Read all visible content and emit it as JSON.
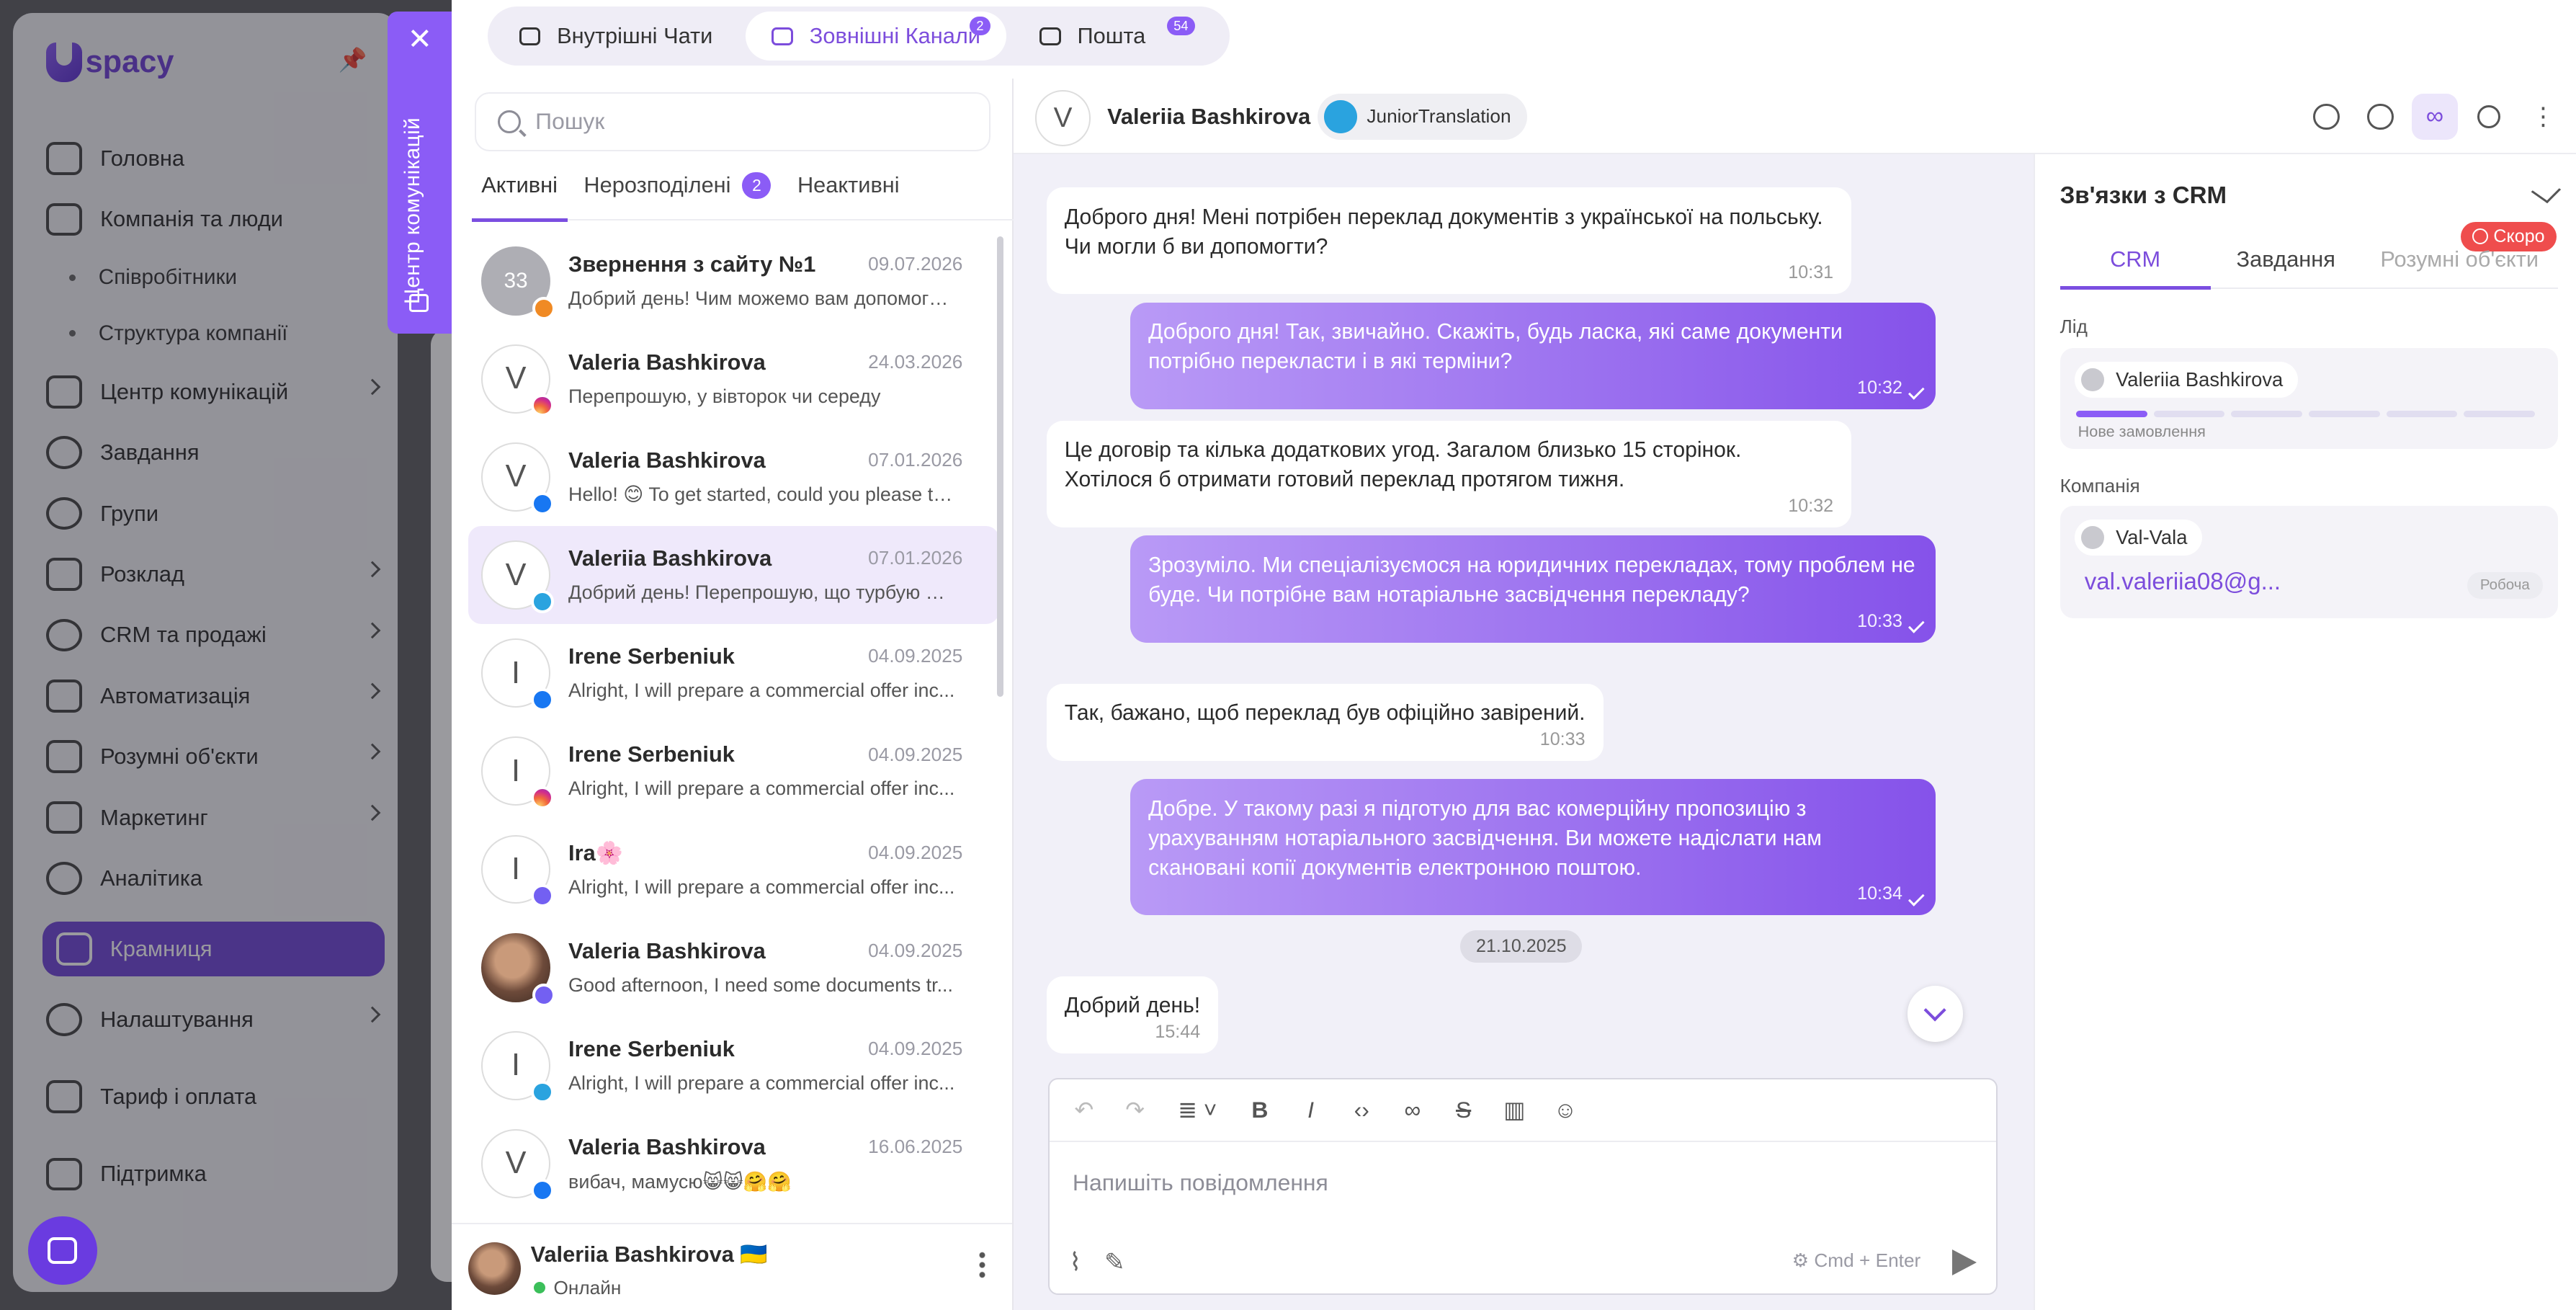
{
  "app": {
    "brand": "spacy",
    "nav": [
      {
        "label": "Головна"
      },
      {
        "label": "Компанія та люди"
      },
      {
        "label": "Співробітники",
        "sub": true
      },
      {
        "label": "Структура компанії",
        "sub": true
      },
      {
        "label": "Центр комунікацій"
      },
      {
        "label": "Завдання"
      },
      {
        "label": "Групи"
      },
      {
        "label": "Розклад"
      },
      {
        "label": "CRM та продажі"
      },
      {
        "label": "Автоматизація"
      },
      {
        "label": "Розумні об'єкти"
      },
      {
        "label": "Маркетинг"
      },
      {
        "label": "Аналітика"
      },
      {
        "label": "Крамниця"
      },
      {
        "label": "Налаштування"
      },
      {
        "label": "Тариф і оплата"
      },
      {
        "label": "Підтримка"
      }
    ]
  },
  "commtab": {
    "label": "Центр комунікацій",
    "close": "✕"
  },
  "tabs": [
    {
      "label": "Внутрішні Чати",
      "badge": ""
    },
    {
      "label": "Зовнішні Канали",
      "badge": "2"
    },
    {
      "label": "Пошта",
      "badge": "54"
    }
  ],
  "search": {
    "placeholder": "Пошук"
  },
  "list_tabs": [
    {
      "label": "Активні"
    },
    {
      "label": "Нерозподілені",
      "count": "2"
    },
    {
      "label": "Неактивні"
    }
  ],
  "chats": [
    {
      "initial": "33",
      "name": "Звернення з сайту №1",
      "date": "09.07.2026",
      "preview": "Добрий день! Чим можемо вам допомогти?",
      "channel": "site"
    },
    {
      "initial": "V",
      "name": "Valeria Bashkirova",
      "date": "24.03.2026",
      "preview": "Перепрошую, у вівторок чи середу",
      "channel": "instagram"
    },
    {
      "initial": "V",
      "name": "Valeria Bashkirova",
      "date": "07.01.2026",
      "preview": "Hello! 😊 To get started, could you please te...",
      "channel": "facebook"
    },
    {
      "initial": "V",
      "name": "Valeriia Bashkirova",
      "date": "07.01.2026",
      "preview": "Добрий день! Перепрошую, що турбую щ...",
      "channel": "telegram"
    },
    {
      "initial": "I",
      "name": "Irene Serbeniuk",
      "date": "04.09.2025",
      "preview": "Alright, I will prepare a commercial offer inc...",
      "channel": "facebook"
    },
    {
      "initial": "I",
      "name": "Irene Serbeniuk",
      "date": "04.09.2025",
      "preview": "Alright, I will prepare a commercial offer inc...",
      "channel": "instagram"
    },
    {
      "initial": "I",
      "name": "Ira🌸",
      "date": "04.09.2025",
      "preview": "Alright, I will prepare a commercial offer inc...",
      "channel": "viber"
    },
    {
      "initial": "",
      "name": "Valeria Bashkirova",
      "date": "04.09.2025",
      "preview": "Good afternoon, I need some documents tr...",
      "channel": "viber"
    },
    {
      "initial": "I",
      "name": "Irene Serbeniuk",
      "date": "04.09.2025",
      "preview": "Alright, I will prepare a commercial offer inc...",
      "channel": "telegram"
    },
    {
      "initial": "V",
      "name": "Valeria Bashkirova",
      "date": "16.06.2025",
      "preview": "вибач, мамусю😸😸🤗🤗",
      "channel": "facebook"
    }
  ],
  "me": {
    "name": "Valeriia Bashkirova 🇺🇦",
    "status": "Онлайн"
  },
  "chat": {
    "initial": "V",
    "name": "Valeriia Bashkirova",
    "bot": "JuniorTranslation",
    "date_separator": "21.10.2025",
    "messages": [
      {
        "dir": "in",
        "text": "Доброго дня! Мені потрібен переклад документів з української на польську. Чи могли б ви допомогти?",
        "time": "10:31"
      },
      {
        "dir": "out",
        "text": "Доброго дня! Так, звичайно. Скажіть, будь ласка, які саме документи потрібно перекласти і в які терміни?",
        "time": "10:32"
      },
      {
        "dir": "in",
        "text": "Це договір та кілька додаткових угод. Загалом близько 15 сторінок. Хотілося б отримати готовий переклад протягом тижня.",
        "time": "10:32"
      },
      {
        "dir": "out",
        "text": "Зрозуміло. Ми спеціалізуємося на юридичних перекладах, тому проблем не буде. Чи потрібне вам нотаріальне засвідчення перекладу?",
        "time": "10:33"
      },
      {
        "dir": "in",
        "text": "Так, бажано, щоб переклад був офіційно завірений.",
        "time": "10:33"
      },
      {
        "dir": "out",
        "text": "Добре. У такому разі я підготую для вас комерційну пропозицію з урахуванням нотаріального засвідчення. Ви можете надіслати нам скановані копії документів електронною поштою.",
        "time": "10:34"
      },
      {
        "dir": "in",
        "text": "Добрий день!",
        "time": "15:44"
      }
    ],
    "composer_placeholder": "Напишіть повідомлення",
    "send_hint": "Cmd + Enter"
  },
  "crm": {
    "title": "Зв'язки з CRM",
    "soon": "Скоро",
    "tabs": [
      "CRM",
      "Завдання",
      "Розумні об'єкти"
    ],
    "lead_label": "Лід",
    "lead_name": "Valeriia Bashkirova",
    "lead_stage": "Нове замовлення",
    "lead_progress": 0.15,
    "company_label": "Компанія",
    "company_name": "Val-Vala",
    "company_email": "val.valeriia08@g...",
    "email_type": "Робоча"
  },
  "colors": {
    "accent": "#7c4ddc",
    "bubble_out_start": "#b99af6",
    "bubble_out_end": "#8552ea",
    "soon_badge": "#ef4d4d"
  }
}
